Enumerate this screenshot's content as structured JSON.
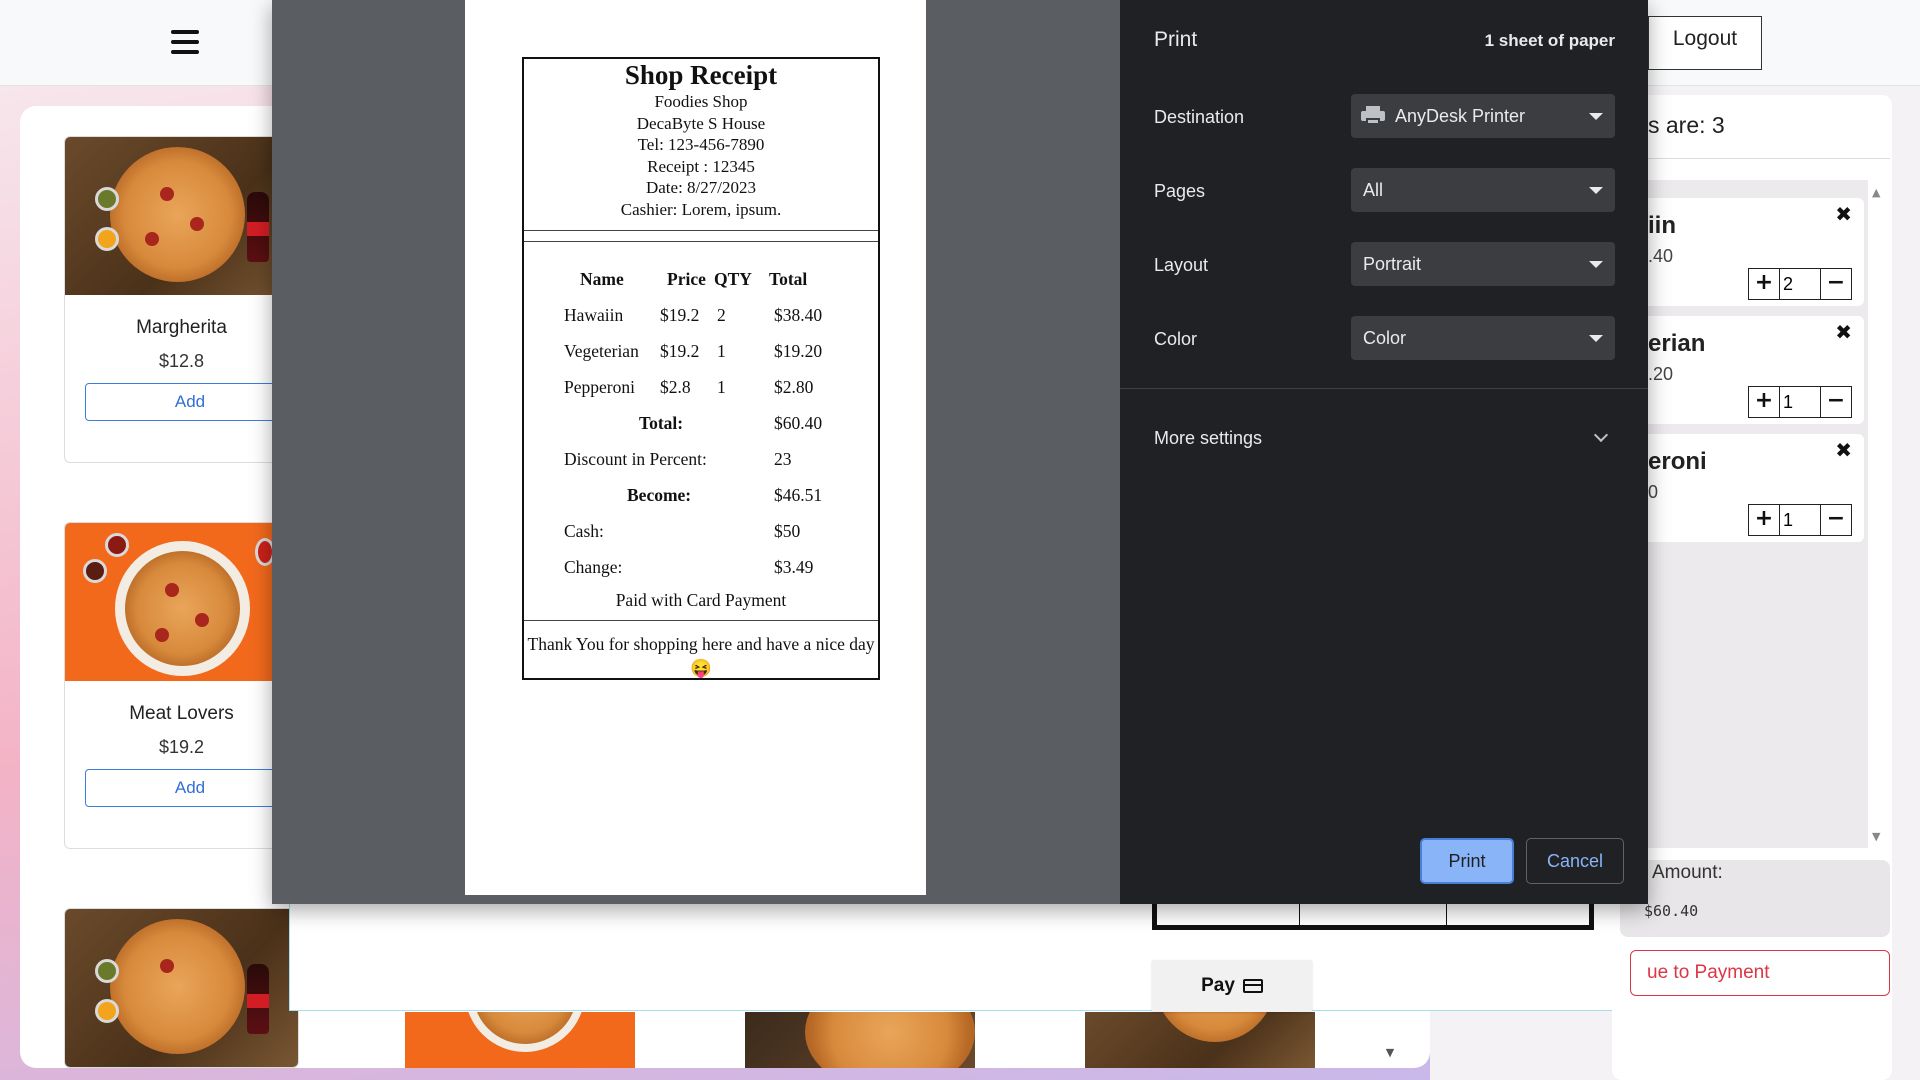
{
  "header": {
    "logout_label": "Logout"
  },
  "products": [
    {
      "name": "Margherita",
      "price": "$12.8",
      "add_label": "Add"
    },
    {
      "name": "Meat Lovers",
      "price": "$19.2",
      "add_label": "Add"
    }
  ],
  "cart": {
    "count_text": "s are: 3",
    "items": [
      {
        "name": "iin",
        "price": ".40",
        "qty": "2"
      },
      {
        "name": "erian",
        "price": ".20",
        "qty": "1"
      },
      {
        "name": "eroni",
        "price": "0",
        "qty": "1"
      }
    ],
    "amount_label": "Amount:",
    "amount_value": "$60.40",
    "continue_label": "ue to Payment"
  },
  "pay": {
    "label": "Pay"
  },
  "print_dialog": {
    "title": "Print",
    "sheets": "1 sheet of paper",
    "destination": {
      "label": "Destination",
      "value": "AnyDesk Printer"
    },
    "pages": {
      "label": "Pages",
      "value": "All"
    },
    "layout": {
      "label": "Layout",
      "value": "Portrait"
    },
    "color": {
      "label": "Color",
      "value": "Color"
    },
    "more_settings": "More settings",
    "print_label": "Print",
    "cancel_label": "Cancel"
  },
  "receipt": {
    "title": "Shop Receipt",
    "shop": "Foodies Shop",
    "address": "DecaByte S House",
    "tel": "Tel: 123-456-7890",
    "receipt_no": "Receipt : 12345",
    "date": "Date: 8/27/2023",
    "cashier": "Cashier: Lorem, ipsum.",
    "headers": {
      "name": "Name",
      "price": "Price",
      "qty": "QTY",
      "total": "Total"
    },
    "rows": [
      {
        "name": "Hawaiin",
        "price": "$19.2",
        "qty": "2",
        "total": "$38.40"
      },
      {
        "name": "Vegeterian",
        "price": "$19.2",
        "qty": "1",
        "total": "$19.20"
      },
      {
        "name": "Pepperoni",
        "price": "$2.8",
        "qty": "1",
        "total": "$2.80"
      }
    ],
    "total_label": "Total:",
    "total_value": "$60.40",
    "discount_label": "Discount in Percent:",
    "discount_value": "23",
    "become_label": "Become:",
    "become_value": "$46.51",
    "cash_label": "Cash:",
    "cash_value": "$50",
    "change_label": "Change:",
    "change_value": "$3.49",
    "paid_with": "Paid with Card Payment",
    "footer": "Thank You for shopping here and have a nice day😝"
  }
}
